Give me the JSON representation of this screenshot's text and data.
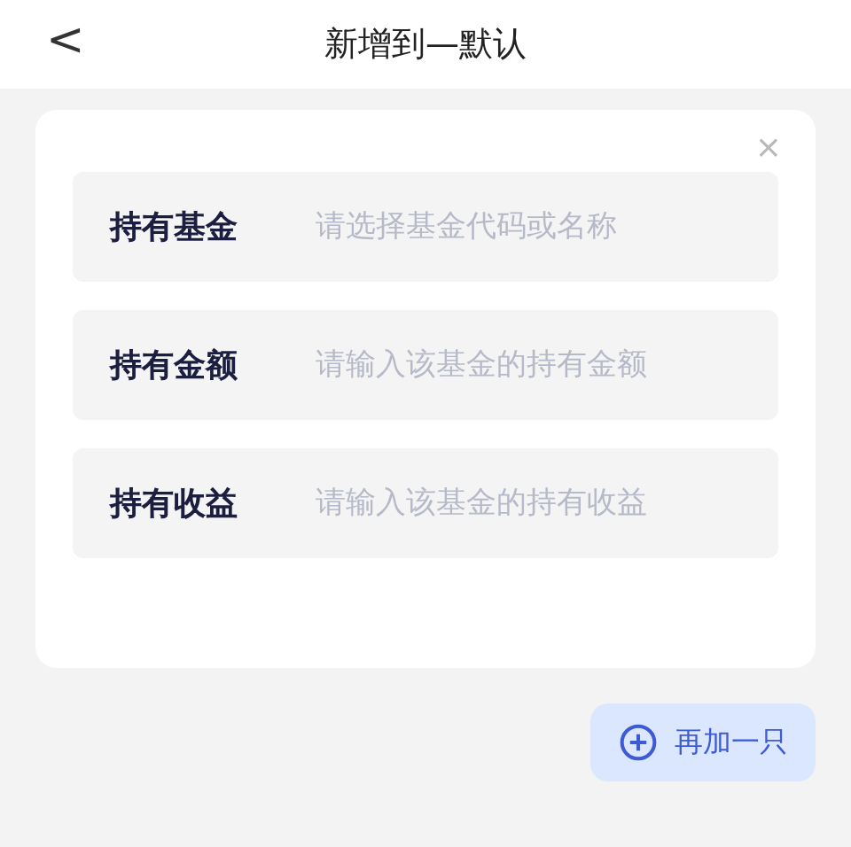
{
  "header": {
    "back": "<",
    "title": "新增到—默认"
  },
  "form": {
    "close": "×",
    "fields": [
      {
        "label": "持有基金",
        "placeholder": "请选择基金代码或名称"
      },
      {
        "label": "持有金额",
        "placeholder": "请输入该基金的持有金额"
      },
      {
        "label": "持有收益",
        "placeholder": "请输入该基金的持有收益"
      }
    ]
  },
  "add_button": {
    "label": "再加一只"
  }
}
